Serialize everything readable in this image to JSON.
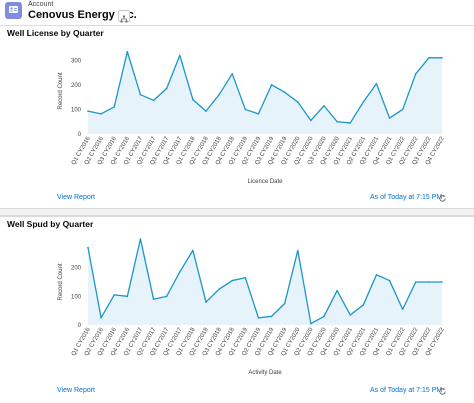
{
  "header": {
    "object_label": "Account",
    "account_name": "Cenovus Energy Inc.",
    "icon": "account-icon",
    "hierarchy_icon": "hierarchy-icon"
  },
  "cards": [
    {
      "title": "Well License by Quarter",
      "view_report": "View Report",
      "as_of": "As of Today at 7:15 PM",
      "refresh_icon": "refresh-icon"
    },
    {
      "title": "Well Spud by Quarter",
      "view_report": "View Report",
      "as_of": "As of Today at 7:15 PM",
      "refresh_icon": "refresh-icon"
    }
  ],
  "colors": {
    "line": "#1b96c8",
    "fill": "#e6f3fb",
    "link": "#0070d2"
  },
  "chart_data": [
    {
      "type": "area",
      "ylabel": "Record Count",
      "xlabel": "Licence Date",
      "ylim": [
        0,
        350
      ],
      "yticks": [
        0,
        100,
        200,
        300
      ],
      "categories": [
        "Q1 CY2016",
        "Q2 CY2016",
        "Q3 CY2016",
        "Q4 CY2016",
        "Q1 CY2017",
        "Q2 CY2017",
        "Q3 CY2017",
        "Q4 CY2017",
        "Q1 CY2018",
        "Q2 CY2018",
        "Q3 CY2018",
        "Q4 CY2018",
        "Q1 CY2019",
        "Q2 CY2019",
        "Q3 CY2019",
        "Q4 CY2019",
        "Q1 CY2020",
        "Q2 CY2020",
        "Q3 CY2020",
        "Q4 CY2020",
        "Q1 CY2021",
        "Q2 CY2021",
        "Q3 CY2021",
        "Q4 CY2021",
        "Q1 CY2022",
        "Q2 CY2022",
        "Q3 CY2022",
        "Q4 CY2022"
      ],
      "values": [
        93,
        82,
        110,
        335,
        160,
        137,
        185,
        320,
        140,
        93,
        160,
        245,
        100,
        82,
        200,
        170,
        130,
        55,
        115,
        50,
        45,
        130,
        205,
        65,
        100,
        245,
        310,
        310
      ],
      "grid": false
    },
    {
      "type": "area",
      "ylabel": "Record Count",
      "xlabel": "Activity Date",
      "ylim": [
        0,
        300
      ],
      "yticks": [
        0,
        100,
        200
      ],
      "categories": [
        "Q1 CY2016",
        "Q2 CY2016",
        "Q3 CY2016",
        "Q4 CY2016",
        "Q1 CY2017",
        "Q2 CY2017",
        "Q3 CY2017",
        "Q4 CY2017",
        "Q1 CY2018",
        "Q2 CY2018",
        "Q3 CY2018",
        "Q4 CY2018",
        "Q1 CY2019",
        "Q2 CY2019",
        "Q3 CY2019",
        "Q4 CY2019",
        "Q1 CY2020",
        "Q2 CY2020",
        "Q3 CY2020",
        "Q4 CY2020",
        "Q1 CY2021",
        "Q2 CY2021",
        "Q3 CY2021",
        "Q4 CY2021",
        "Q1 CY2022",
        "Q2 CY2022",
        "Q3 CY2022",
        "Q4 CY2022"
      ],
      "values": [
        270,
        25,
        105,
        100,
        300,
        90,
        100,
        185,
        260,
        80,
        125,
        155,
        165,
        25,
        30,
        75,
        260,
        5,
        30,
        120,
        35,
        70,
        175,
        155,
        55,
        150,
        150,
        150
      ],
      "grid": false
    }
  ]
}
